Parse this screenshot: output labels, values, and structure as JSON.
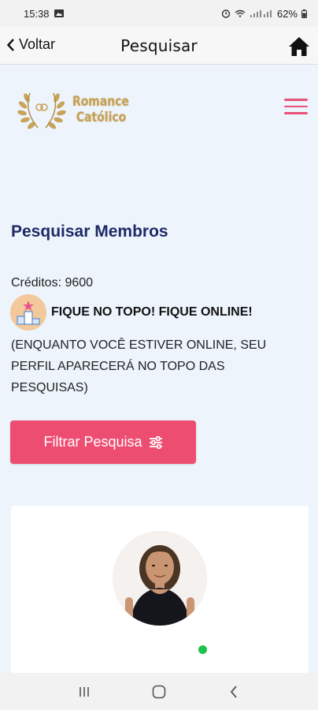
{
  "status_bar": {
    "time": "15:38",
    "battery": "62%"
  },
  "header": {
    "back_label": "Voltar",
    "title": "Pesquisar"
  },
  "logo": {
    "line1": "Romance",
    "line2": "Católico"
  },
  "page": {
    "section_title": "Pesquisar Membros",
    "credits": "Créditos: 9600",
    "promo_headline": "FIQUE NO TOPO! FIQUE ONLINE!",
    "promo_description": "(ENQUANTO VOCÊ ESTIVER ONLINE, SEU PERFIL APARECERÁ NO TOPO DAS PESQUISAS)",
    "filter_button_label": "Filtrar Pesquisa"
  },
  "member_card": {
    "online": true
  },
  "colors": {
    "accent": "#ee4d72",
    "title": "#1e2a66",
    "logo_gold": "#c8a35a",
    "online": "#1fc24a"
  }
}
